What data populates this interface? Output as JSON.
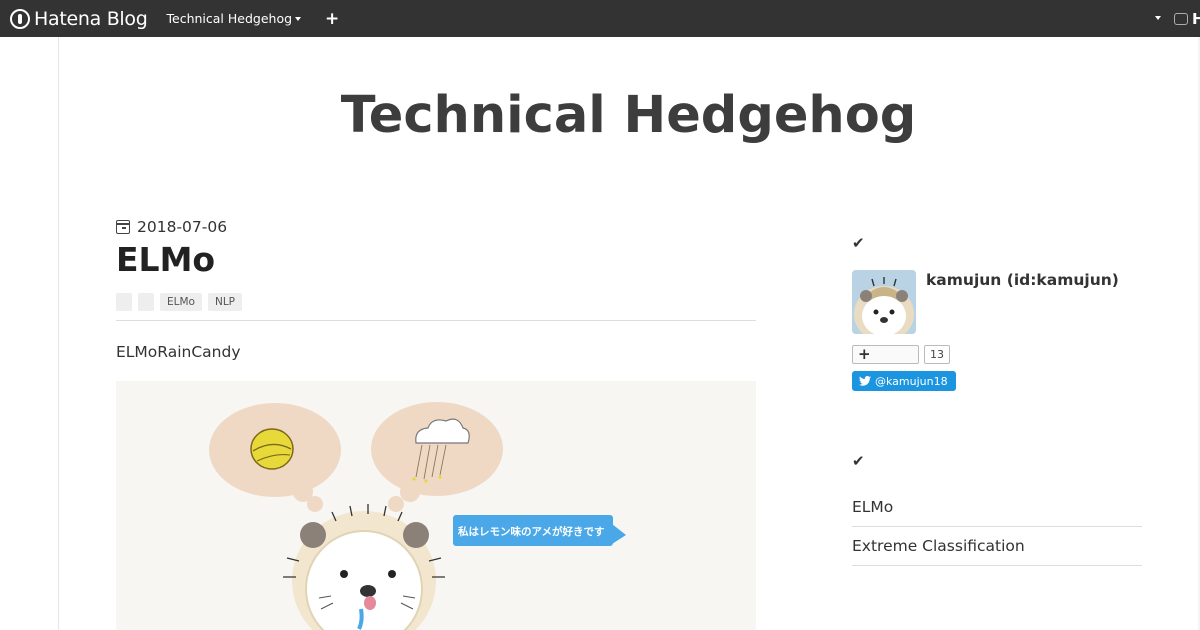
{
  "topbar": {
    "logo_text": "Hatena Blog",
    "blog_switch_label": "Technical Hedgehog",
    "add_label": "+",
    "right_logo_text": "H"
  },
  "blog": {
    "title": "Technical Hedgehog"
  },
  "entry": {
    "date": "2018-07-06",
    "title": "ELMo",
    "tags": [
      "",
      "",
      "ELMo",
      "NLP"
    ],
    "body_text": "ELMoRainCandy",
    "illustration": {
      "speech_bubble": "私はレモン味のアメが好きです"
    }
  },
  "sidebar": {
    "profile": {
      "check_icon": "check-icon",
      "author": "kamujun (id:kamujun)",
      "subscribe_label": "+",
      "subscribe_count": "13",
      "twitter_label": "@kamujun18"
    },
    "categories": {
      "check_icon": "check-icon",
      "items": [
        "ELMo",
        "Extreme Classification"
      ]
    }
  },
  "colors": {
    "topbar": "#333333",
    "twitter": "#1b95e0",
    "bubble": "#efd9c5",
    "speech": "#4aa8e8"
  }
}
